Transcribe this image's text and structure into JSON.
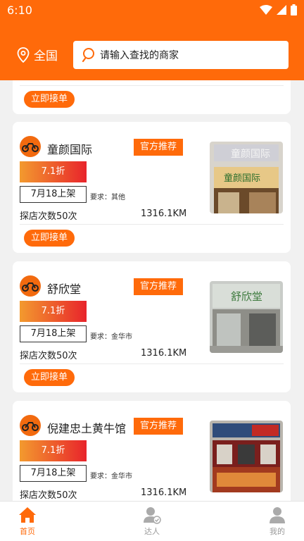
{
  "status_bar": {
    "time": "6:10"
  },
  "header": {
    "location": "全国",
    "search_placeholder": "请输入查找的商家"
  },
  "partial_card": {
    "action_label": "立即接单"
  },
  "shops": [
    {
      "name": "童颜国际",
      "recommend_label": "官方推荐",
      "discount": "7.1折",
      "listing_date": "7月18上架",
      "requirement": "要求：其他",
      "visits": "探店次数50次",
      "distance": "1316.1KM",
      "action_label": "立即接单",
      "photo_icon": "storefront-photo-tongyan"
    },
    {
      "name": "舒欣堂",
      "recommend_label": "官方推荐",
      "discount": "7.1折",
      "listing_date": "7月18上架",
      "requirement": "要求：金华市",
      "visits": "探店次数50次",
      "distance": "1316.1KM",
      "action_label": "立即接单",
      "photo_icon": "storefront-photo-shuxintang"
    },
    {
      "name": "倪建忠土黄牛馆",
      "recommend_label": "官方推荐",
      "discount": "7.1折",
      "listing_date": "7月18上架",
      "requirement": "要求：金华市",
      "visits": "探店次数50次",
      "distance": "1316.1KM",
      "photo_icon": "storefront-photo-beef-restaurant"
    }
  ],
  "tabbar": {
    "tabs": [
      {
        "label": "首页",
        "icon": "home-icon",
        "active": true
      },
      {
        "label": "达人",
        "icon": "influencer-icon",
        "active": false
      },
      {
        "label": "我的",
        "icon": "profile-icon",
        "active": false
      }
    ]
  },
  "colors": {
    "brand": "#ff6a0a",
    "discount_start": "#f39a2e",
    "discount_end": "#e8242b"
  }
}
